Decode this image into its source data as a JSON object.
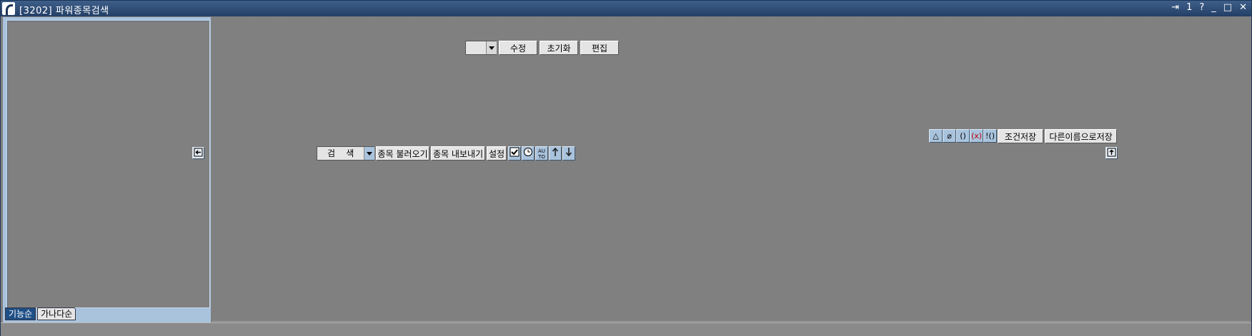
{
  "window": {
    "title": "[3202] 파워종목검색",
    "controls": [
      "⇥",
      "1",
      "?",
      "_",
      "□",
      "✕"
    ]
  },
  "left_tabs": {
    "active": "기능순",
    "inactive": "가나다순"
  },
  "top_toolbar": {
    "select_value": "",
    "edit_label": "수정",
    "reset_label": "초기화",
    "edit2_label": "편집"
  },
  "right_toolbar": {
    "icons": [
      "triangle-icon",
      "eraser-icon",
      "parens-icon",
      "x-parens-icon",
      "not-parens-icon"
    ],
    "icon_glyphs": [
      "△",
      "⌀",
      "()",
      "(x)",
      "!()"
    ],
    "save_label": "조건저장",
    "save_as_label": "다른이름으로저장"
  },
  "search_bar": {
    "search_select": "검    색",
    "load_label": "종목 불러오기",
    "export_label": "종목 내보내기",
    "settings_label": "설정",
    "auto_label": "AU TO"
  }
}
